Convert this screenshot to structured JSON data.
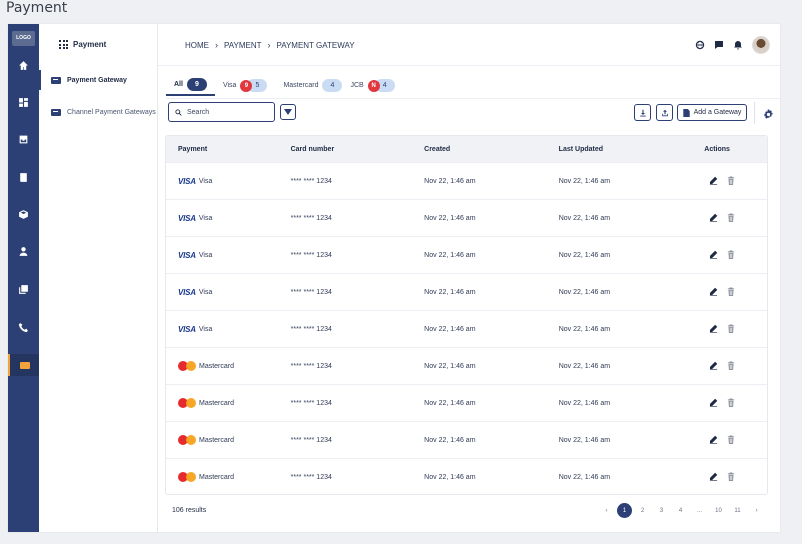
{
  "page_title": "Payment",
  "rail": {
    "logo": "LOGO",
    "icons": [
      "home-icon",
      "dashboard-icon",
      "inbox-icon",
      "book-icon",
      "box-icon",
      "user-icon",
      "library-icon",
      "phone-icon",
      "payment-card-icon"
    ]
  },
  "subnav": {
    "title": "Payment",
    "items": [
      {
        "label": "Payment Gateway"
      },
      {
        "label": "Channel Payment Gateways"
      }
    ]
  },
  "breadcrumb": [
    "HOME",
    "PAYMENT",
    "PAYMENT GATEWAY"
  ],
  "tabs": [
    {
      "label": "All",
      "count": "9"
    },
    {
      "label": "Visa",
      "badge": "9",
      "count": "5"
    },
    {
      "label": "Mastercard",
      "count": "4"
    },
    {
      "label": "JCB",
      "badge": "N",
      "count": "4"
    }
  ],
  "toolbar": {
    "search_placeholder": "Search",
    "add_label": "Add a Gateway"
  },
  "table": {
    "headers": [
      "Payment",
      "Card number",
      "Created",
      "Last Updated",
      "Actions"
    ],
    "rows": [
      {
        "brand": "VISA",
        "name": "Visa",
        "card": "**** **** 1234",
        "created": "Nov 22, 1:46 am",
        "updated": "Nov 22, 1:46 am"
      },
      {
        "brand": "VISA",
        "name": "Visa",
        "card": "**** **** 1234",
        "created": "Nov 22, 1:46 am",
        "updated": "Nov 22, 1:46 am"
      },
      {
        "brand": "VISA",
        "name": "Visa",
        "card": "**** **** 1234",
        "created": "Nov 22, 1:46 am",
        "updated": "Nov 22, 1:46 am"
      },
      {
        "brand": "VISA",
        "name": "Visa",
        "card": "**** **** 1234",
        "created": "Nov 22, 1:46 am",
        "updated": "Nov 22, 1:46 am"
      },
      {
        "brand": "VISA",
        "name": "Visa",
        "card": "**** **** 1234",
        "created": "Nov 22, 1:46 am",
        "updated": "Nov 22, 1:46 am"
      },
      {
        "brand": "MC",
        "name": "Mastercard",
        "card": "**** **** 1234",
        "created": "Nov 22, 1:46 am",
        "updated": "Nov 22, 1:46 am"
      },
      {
        "brand": "MC",
        "name": "Mastercard",
        "card": "**** **** 1234",
        "created": "Nov 22, 1:46 am",
        "updated": "Nov 22, 1:46 am"
      },
      {
        "brand": "MC",
        "name": "Mastercard",
        "card": "**** **** 1234",
        "created": "Nov 22, 1:46 am",
        "updated": "Nov 22, 1:46 am"
      },
      {
        "brand": "MC",
        "name": "Mastercard",
        "card": "**** **** 1234",
        "created": "Nov 22, 1:46 am",
        "updated": "Nov 22, 1:46 am"
      }
    ]
  },
  "footer": {
    "results": "106 results",
    "pages": [
      "1",
      "2",
      "3",
      "4",
      "...",
      "10",
      "11"
    ]
  },
  "colors": {
    "primary": "#2c4075",
    "accent": "#f2a33a",
    "badge_red": "#e0383e",
    "pill_light": "#c9dcf3"
  }
}
